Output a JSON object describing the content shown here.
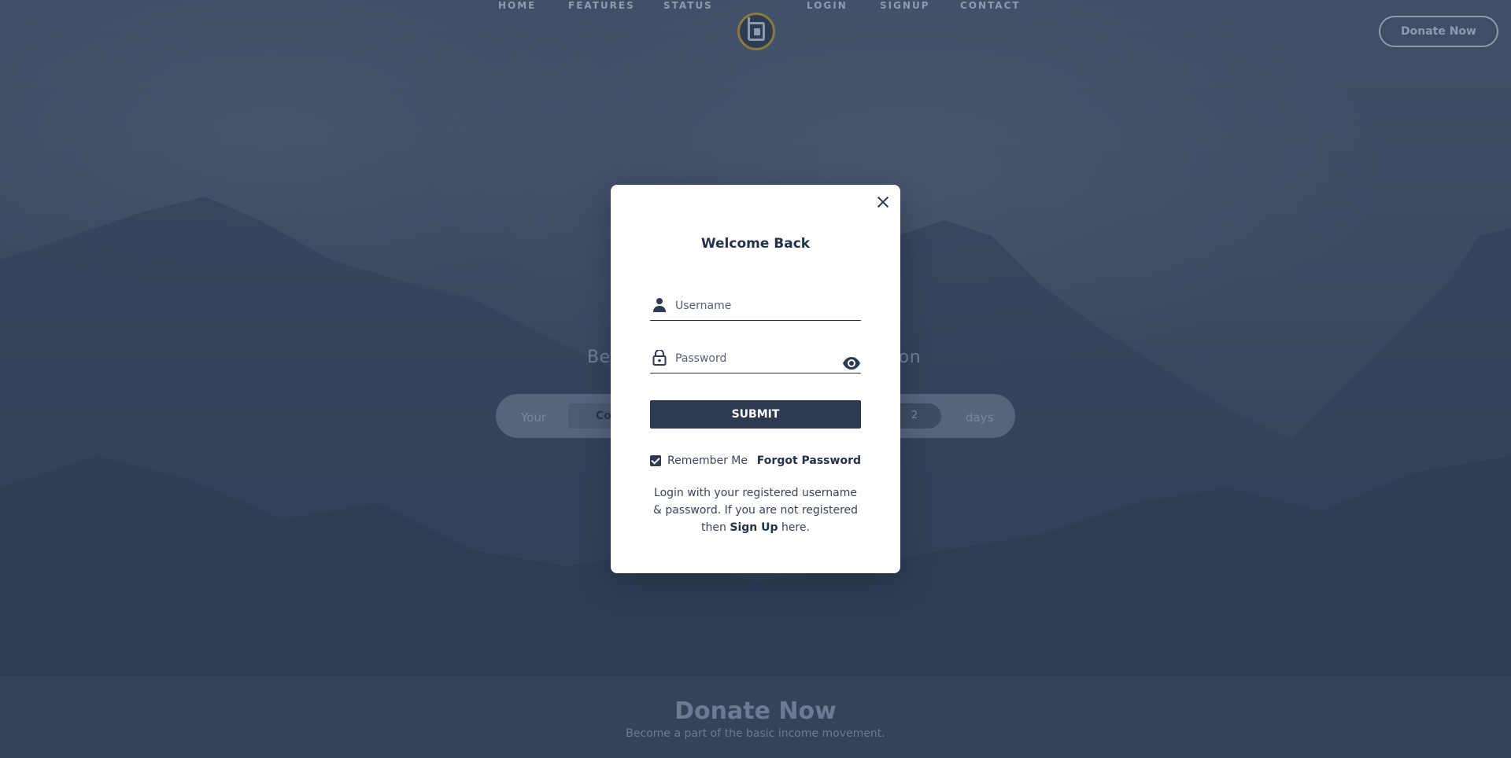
{
  "nav": {
    "links": [
      "HOME",
      "FEATURES",
      "STATUS",
      "LOGIN",
      "SIGNUP",
      "CONTACT"
    ],
    "donate_label": "Donate Now"
  },
  "hero": {
    "subtitle_left": "Bec",
    "subtitle_right": "tion",
    "calc_your": "Your",
    "calc_country": "Co",
    "calc_number": "2",
    "calc_days": "days"
  },
  "footer": {
    "title": "Donate Now",
    "subtitle": "Become a part of the basic income movement."
  },
  "modal": {
    "title": "Welcome Back",
    "username_placeholder": "Username",
    "password_placeholder": "Password",
    "submit_label": "SUBMIT",
    "remember_label": "Remember Me",
    "remember_checked": true,
    "forgot_label": "Forgot Password",
    "note_prefix": "Login with your registered username & password. If you are not registered then ",
    "note_link": "Sign Up",
    "note_suffix": " here."
  },
  "colors": {
    "primary": "#2d3a52",
    "overlay": "#3b4a62",
    "logo_ring": "#8b7a3e"
  }
}
